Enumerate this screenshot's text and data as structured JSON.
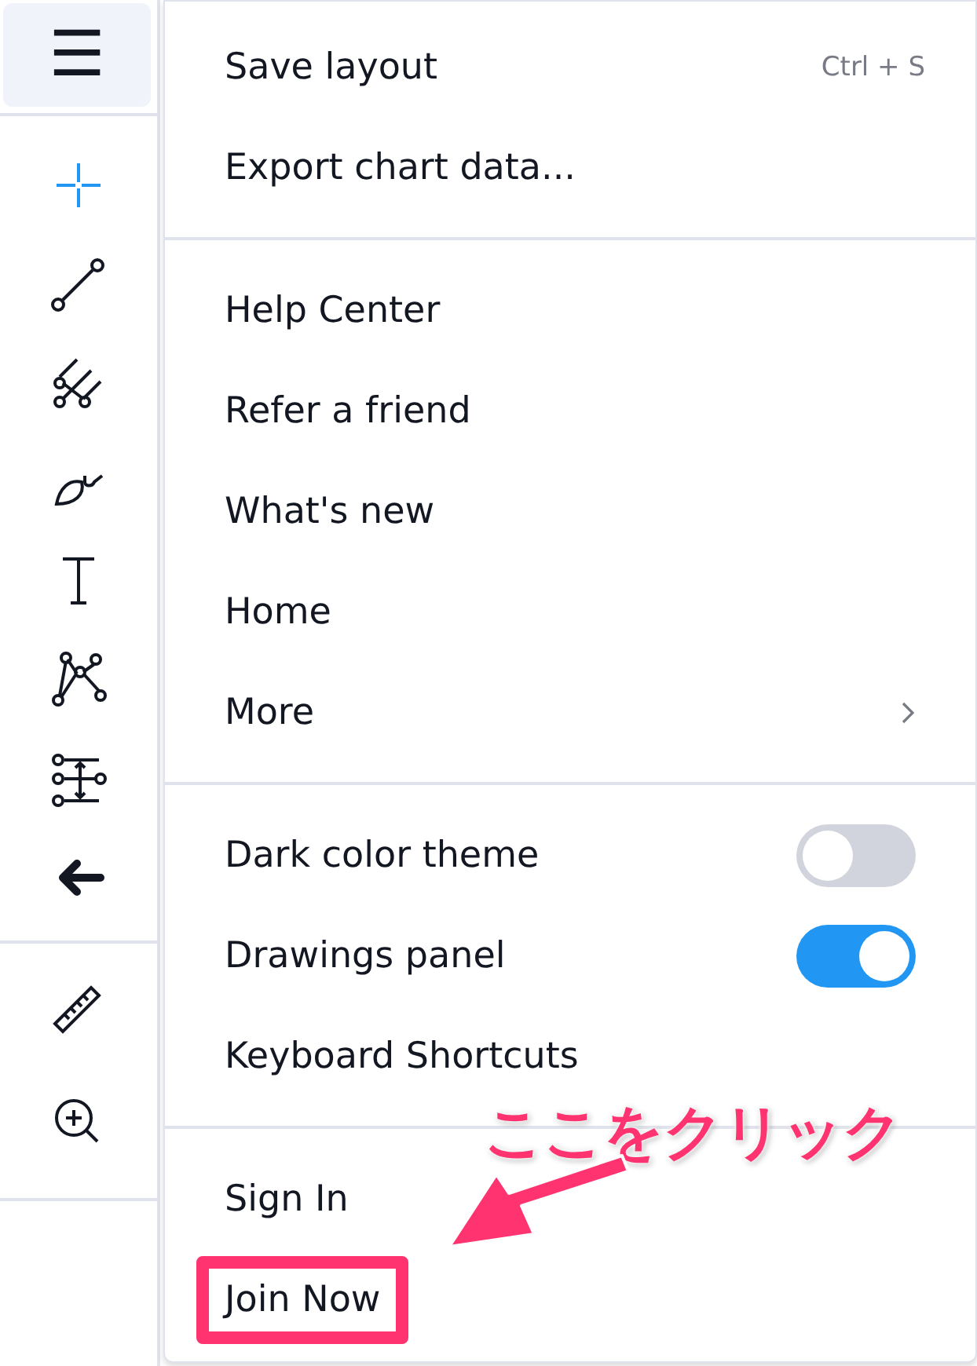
{
  "toolbar": {
    "menu_button": {
      "label": "☰"
    },
    "tools": [
      {
        "kind": "cursor",
        "selected": true
      },
      {
        "kind": "trendline",
        "selected": false
      },
      {
        "kind": "fork",
        "selected": false
      },
      {
        "kind": "brush",
        "selected": false
      },
      {
        "kind": "text",
        "selected": false
      },
      {
        "kind": "pattern",
        "selected": false
      },
      {
        "kind": "range",
        "selected": false
      },
      {
        "kind": "arrow",
        "selected": false
      }
    ],
    "tools_bottom": [
      {
        "kind": "ruler",
        "selected": false
      },
      {
        "kind": "zoom",
        "selected": false
      }
    ]
  },
  "menu": {
    "sections": [
      [
        {
          "kind": "plain",
          "label": "Save layout",
          "shortcut": "Ctrl + S",
          "highlighted": false
        },
        {
          "kind": "plain",
          "label": "Export chart data...",
          "highlighted": false
        }
      ],
      [
        {
          "kind": "plain",
          "label": "Help Center",
          "highlighted": false
        },
        {
          "kind": "plain",
          "label": "Refer a friend",
          "highlighted": false
        },
        {
          "kind": "plain",
          "label": "What's new",
          "highlighted": false
        },
        {
          "kind": "plain",
          "label": "Home",
          "highlighted": false
        },
        {
          "kind": "submenu",
          "label": "More",
          "highlighted": false
        }
      ],
      [
        {
          "kind": "toggle",
          "label": "Dark color theme",
          "on": false,
          "highlighted": false
        },
        {
          "kind": "toggle",
          "label": "Drawings panel",
          "on": true,
          "highlighted": false
        },
        {
          "kind": "plain",
          "label": "Keyboard Shortcuts",
          "highlighted": false
        }
      ],
      [
        {
          "kind": "plain",
          "label": "Sign In",
          "highlighted": false
        },
        {
          "kind": "plain",
          "label": "Join Now",
          "highlighted": true
        }
      ]
    ]
  },
  "annotation": {
    "text": "ここをクリック"
  }
}
